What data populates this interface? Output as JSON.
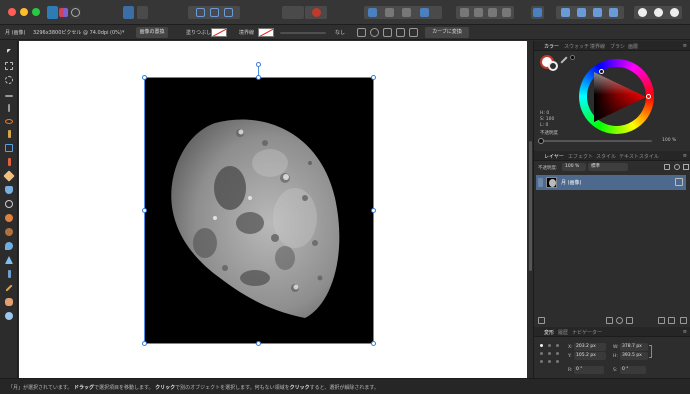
{
  "titlebar": {
    "traffic_lights": [
      {
        "name": "close",
        "color": "#ff5f57"
      },
      {
        "name": "minimize",
        "color": "#febc2e"
      },
      {
        "name": "zoom",
        "color": "#28c840"
      }
    ]
  },
  "context_toolbar": {
    "doc_name": "月 (画像)",
    "doc_info": "3296x3800ピクセル @ 74.0dpi (0%)",
    "replace_image_label": "画像の置換",
    "fill_label": "塗りつぶし",
    "stroke_label": "境界線",
    "stroke_width_value": "なし",
    "convert_to_curves_label": "カーブに変換"
  },
  "color_panel": {
    "tabs": [
      "カラー",
      "スウォッチ",
      "境界線",
      "ブラシ",
      "画層"
    ],
    "active_tab": "カラー",
    "hsl": {
      "h": "H: 0",
      "s": "S: 100",
      "l": "L: 0"
    },
    "opacity_label": "不透明度",
    "opacity_value": "100 %"
  },
  "layers_panel": {
    "tabs": [
      "レイヤー",
      "エフェクト",
      "スタイル",
      "テキストスタイル"
    ],
    "active_tab": "レイヤー",
    "opacity_label": "不透明度:",
    "opacity_value": "100 %",
    "blend_mode": "標準",
    "layers": [
      {
        "name": "月 (画像)",
        "selected": true
      }
    ]
  },
  "transform_panel": {
    "tabs": [
      "変形",
      "履歴",
      "ナビゲーター"
    ],
    "active_tab": "変形",
    "x_label": "X:",
    "x_value": "203.2 px",
    "y_label": "Y:",
    "y_value": "105.2 px",
    "w_label": "W:",
    "w_value": "378.7 px",
    "h_label": "H:",
    "h_value": "393.5 px",
    "r_label": "R:",
    "r_value": "0 °",
    "s_label": "S:",
    "s_value": "0 °"
  },
  "statusbar": {
    "text_pre": "「月」が選択されています。",
    "drag_word": "ドラッグ",
    "text_mid1": "で選択項目を移動します。",
    "click_word": "クリック",
    "text_mid2": "で別のオブジェクトを選択します。何もない領域を",
    "click_word2": "クリック",
    "text_post": "すると、選択が解除されます。"
  },
  "colors": {
    "selection_blue": "#4a90e2",
    "layer_selected": "#4d6a8e",
    "app_background": "#2b2b2b"
  }
}
